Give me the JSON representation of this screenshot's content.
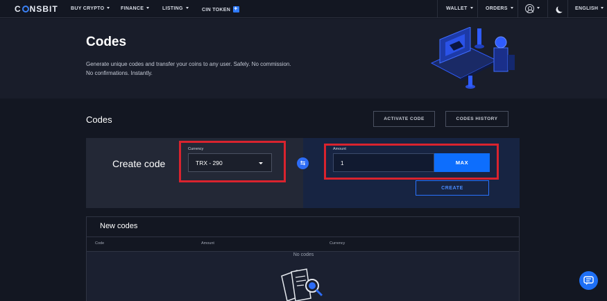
{
  "nav": {
    "logo_pre": "C",
    "logo_post": "NSBIT",
    "buy_crypto": "BUY CRYPTO",
    "finance": "FINANCE",
    "listing": "LISTING",
    "cin_token": "CIN TOKEN",
    "wallet": "WALLET",
    "orders": "ORDERS",
    "language": "ENGLISH"
  },
  "hero": {
    "title": "Codes",
    "description": "Generate unique codes and transfer your coins to any user. Safely. No commission. No confirmations. Instantly."
  },
  "codes_section": {
    "title": "Codes",
    "activate_code": "ACTIVATE CODE",
    "codes_history": "CODES HISTORY"
  },
  "create_code": {
    "title": "Create code",
    "currency_label": "Currency",
    "currency_value": "TRX - 290",
    "amount_label": "Amount",
    "amount_value": "1",
    "max_label": "MAX",
    "create_label": "CREATE"
  },
  "new_codes": {
    "title": "New codes",
    "columns": [
      "Code",
      "Amount",
      "Currency"
    ],
    "empty_text": "No codes"
  },
  "colors": {
    "background": "#131722",
    "accent": "#0d6efd",
    "highlight": "#d9232e"
  }
}
